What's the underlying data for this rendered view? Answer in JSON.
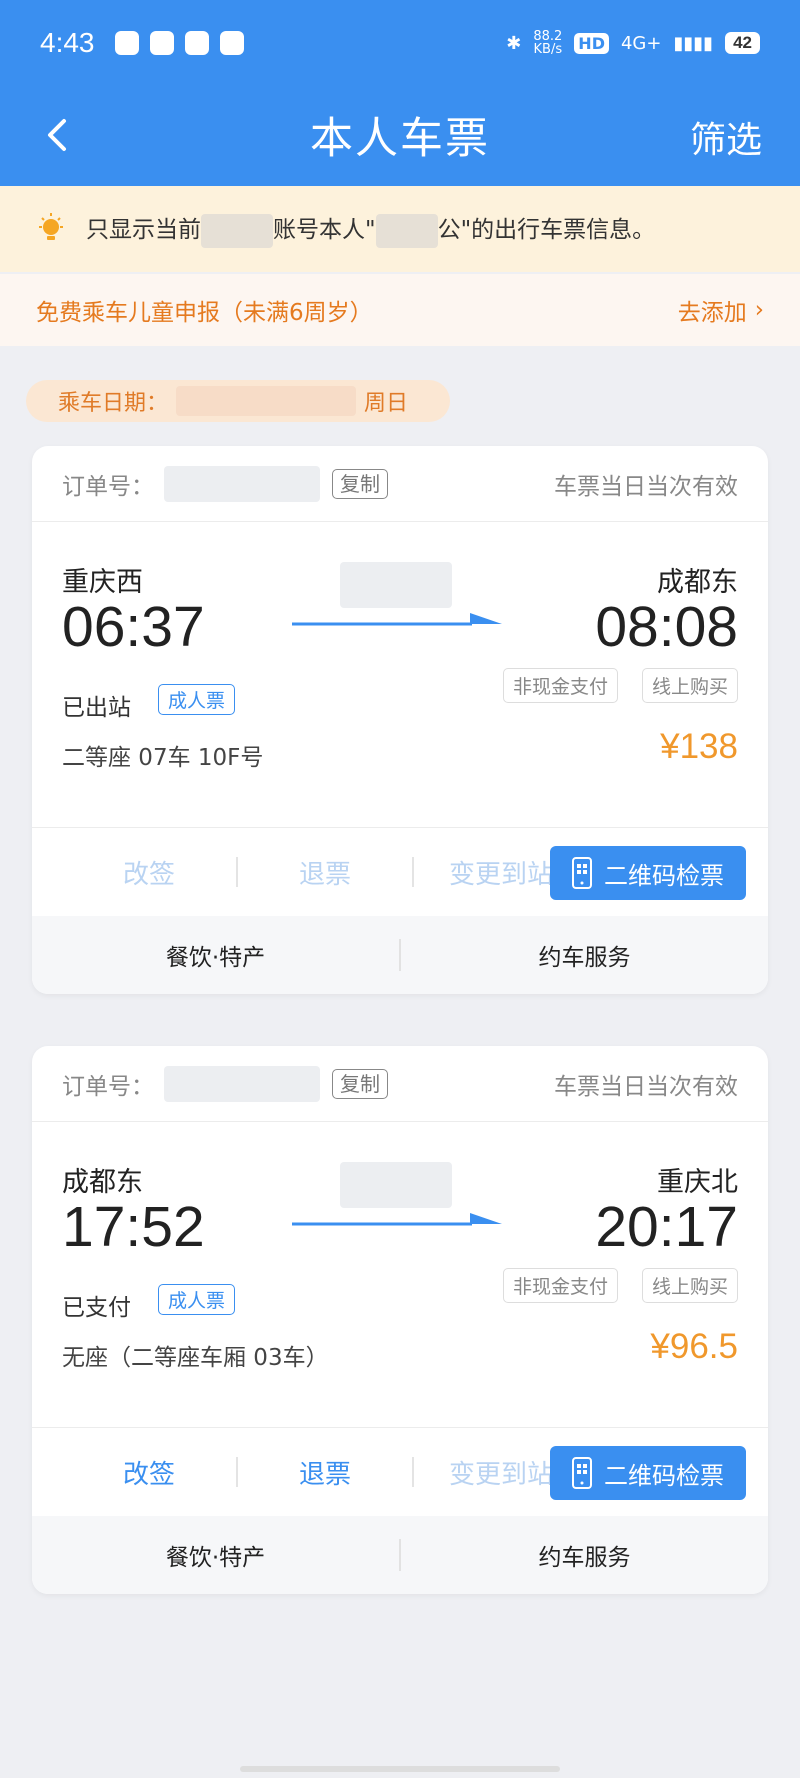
{
  "status_bar": {
    "time": "4:43",
    "speed_value": "88.2",
    "speed_unit": "KB/s",
    "hd": "HD",
    "signal": "4G+",
    "battery": "42"
  },
  "nav": {
    "title": "本人车票",
    "filter_label": "筛选"
  },
  "notice": {
    "prefix": "只显示当前",
    "middle": "账号本人\"",
    "suffix_char": "公",
    "suffix": "\"的出行车票信息。"
  },
  "child": {
    "text": "免费乘车儿童申报（未满6周岁）",
    "add_label": "去添加"
  },
  "date": {
    "label": "乘车日期：",
    "weekday": "周日"
  },
  "tickets": [
    {
      "order_label": "订单号：",
      "copy_label": "复制",
      "valid_text": "车票当日当次有效",
      "from_station": "重庆西",
      "to_station": "成都东",
      "depart_time": "06:37",
      "arrive_time": "08:08",
      "status": "已出站",
      "ticket_type": "成人票",
      "pay_tag": "非现金支付",
      "online_tag": "线上购买",
      "seat": "二等座 07车 10F号",
      "price": "¥138",
      "actions": [
        "改签",
        "退票",
        "变更到站"
      ],
      "qr_label": "二维码检票",
      "services": [
        "餐饮·特产",
        "约车服务"
      ]
    },
    {
      "order_label": "订单号：",
      "copy_label": "复制",
      "valid_text": "车票当日当次有效",
      "from_station": "成都东",
      "to_station": "重庆北",
      "depart_time": "17:52",
      "arrive_time": "20:17",
      "status": "已支付",
      "ticket_type": "成人票",
      "pay_tag": "非现金支付",
      "online_tag": "线上购买",
      "seat": "无座（二等座车厢 03车）",
      "price": "¥96.5",
      "actions": [
        "改签",
        "退票",
        "变更到站"
      ],
      "qr_label": "二维码检票",
      "services": [
        "餐饮·特产",
        "约车服务"
      ]
    }
  ],
  "icons": {
    "back": "chevron-left-icon",
    "bulb": "lightbulb-icon",
    "qr": "phone-icon",
    "bluetooth": "bluetooth-icon"
  },
  "colors": {
    "primary": "#3a8ff0",
    "price": "#f0982c",
    "warning": "#e57a1f"
  }
}
